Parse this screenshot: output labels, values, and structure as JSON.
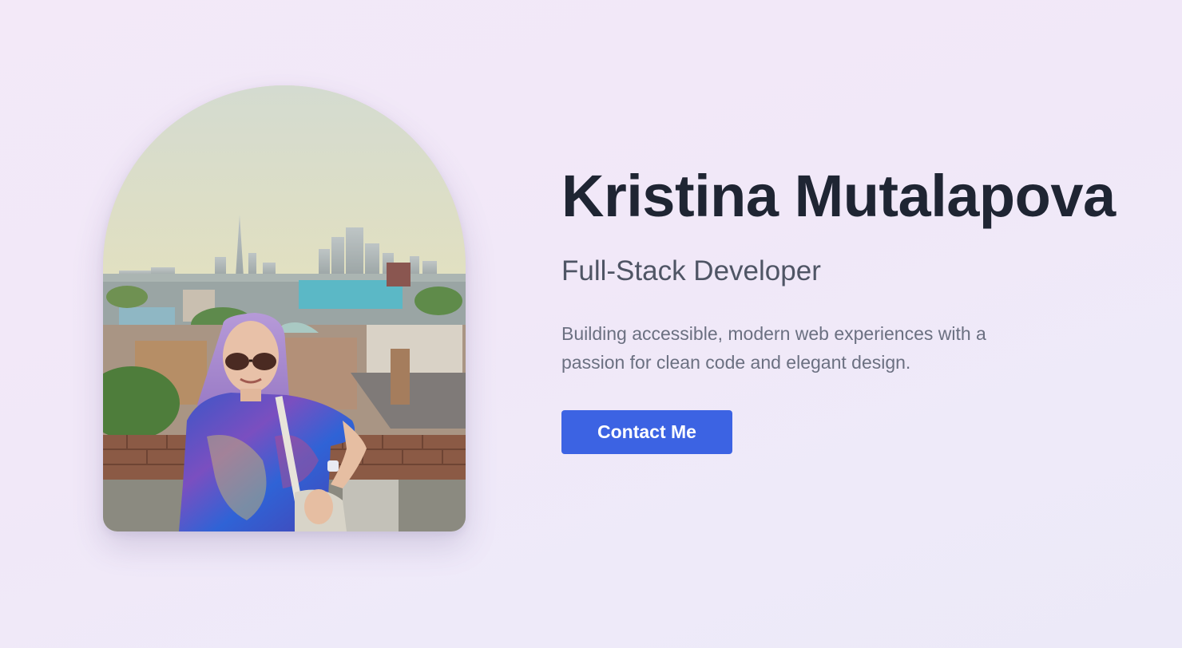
{
  "profile": {
    "name": "Kristina Mutalapova",
    "role": "Full-Stack Developer",
    "bio": "Building accessible, modern web experiences with a passion for clean code and elegant design.",
    "contact_label": "Contact Me"
  },
  "colors": {
    "accent": "#3c63e3",
    "heading": "#1f2533",
    "subheading": "#4f5565",
    "body_text": "#6b7081",
    "background": "#f1e8f8"
  }
}
